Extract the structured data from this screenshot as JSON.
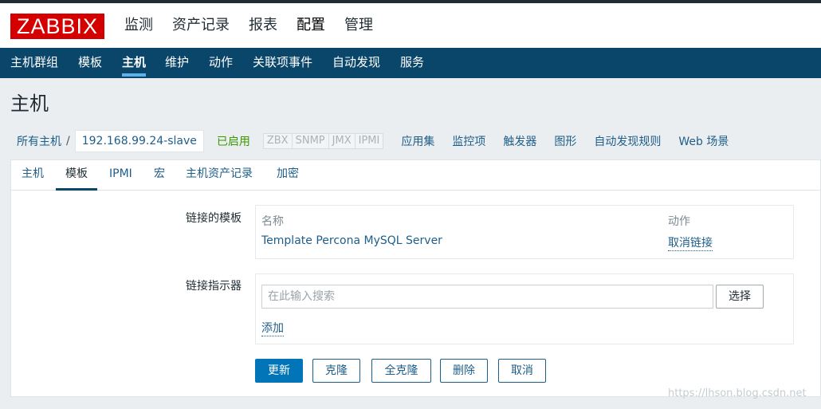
{
  "app": {
    "logo": "ZABBIX"
  },
  "top_nav": [
    "监测",
    "资产记录",
    "报表",
    "配置",
    "管理"
  ],
  "sub_nav": [
    "主机群组",
    "模板",
    "主机",
    "维护",
    "动作",
    "关联项事件",
    "自动发现",
    "服务"
  ],
  "page_title": "主机",
  "breadcrumb": {
    "all_hosts": "所有主机",
    "separator": "/",
    "current_host": "192.168.99.24-slave",
    "status": "已启用",
    "availability": [
      "ZBX",
      "SNMP",
      "JMX",
      "IPMI"
    ],
    "links": [
      "应用集",
      "监控项",
      "触发器",
      "图形",
      "自动发现规则",
      "Web 场景"
    ]
  },
  "tabs": [
    "主机",
    "模板",
    "IPMI",
    "宏",
    "主机资产记录",
    "加密"
  ],
  "linked_templates": {
    "label": "链接的模板",
    "col_name": "名称",
    "col_action": "动作",
    "template_name": "Template Percona MySQL Server",
    "unlink_label": "取消链接"
  },
  "link_indicator": {
    "label": "链接指示器",
    "search_placeholder": "在此输入搜索",
    "select_label": "选择",
    "add_label": "添加"
  },
  "buttons": {
    "update": "更新",
    "clone": "克隆",
    "full_clone": "全克隆",
    "delete": "删除",
    "cancel": "取消"
  },
  "watermark": "https://lhson.blog.csdn.net",
  "colors": {
    "logo_red": "#d40000",
    "subnav_bg": "#0a466a",
    "link_blue": "#1e5e8a",
    "primary_button": "#0275b8",
    "enabled_green": "#3a9a00"
  }
}
